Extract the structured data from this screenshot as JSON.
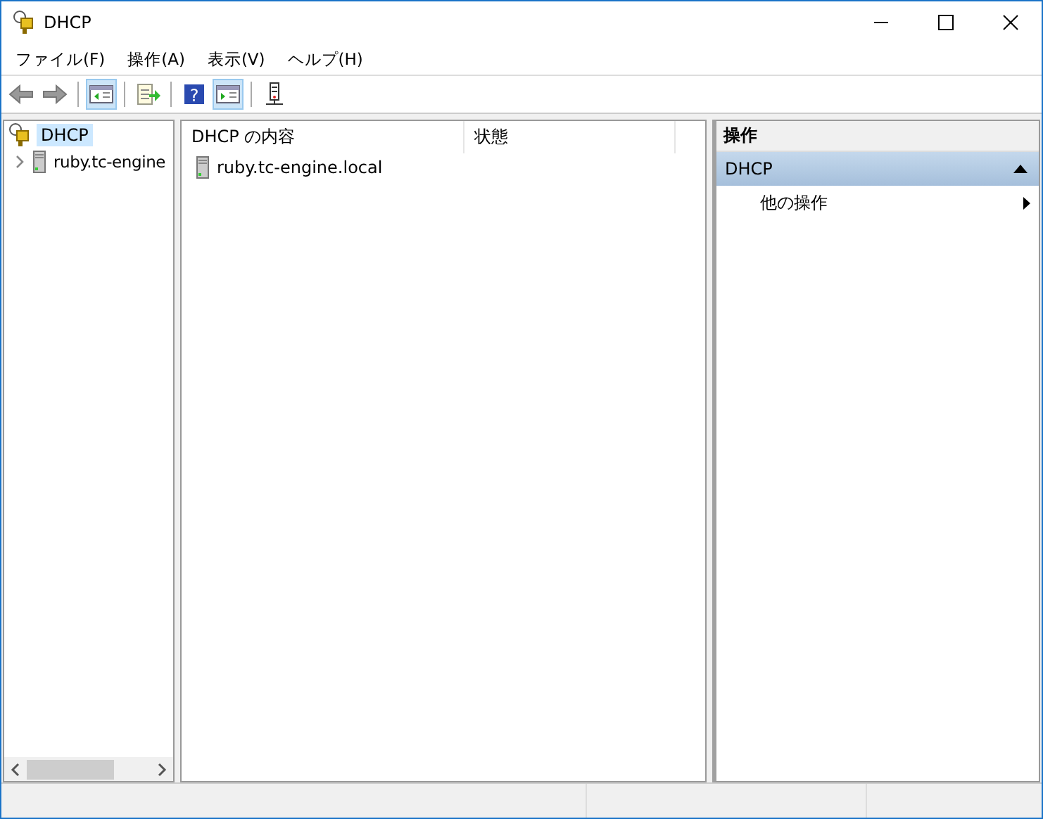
{
  "window": {
    "title": "DHCP"
  },
  "menu": [
    {
      "label": "ファイル(F)"
    },
    {
      "label": "操作(A)"
    },
    {
      "label": "表示(V)"
    },
    {
      "label": "ヘルプ(H)"
    }
  ],
  "toolbar": [
    {
      "kind": "back",
      "selected": false
    },
    {
      "kind": "forward",
      "selected": false
    },
    {
      "kind": "sep"
    },
    {
      "kind": "tree",
      "selected": true
    },
    {
      "kind": "sep"
    },
    {
      "kind": "export",
      "selected": false
    },
    {
      "kind": "sep"
    },
    {
      "kind": "help",
      "selected": false,
      "glyph": "?"
    },
    {
      "kind": "actionpane",
      "selected": true
    },
    {
      "kind": "sep"
    },
    {
      "kind": "device",
      "selected": false
    }
  ],
  "tree": [
    {
      "label": "DHCP",
      "selected": true,
      "children": [
        {
          "label": "ruby.tc-engine",
          "selected": false,
          "expanded": false
        }
      ]
    }
  ],
  "table": {
    "columns": [
      "DHCP の内容",
      "状態"
    ],
    "rows": [
      {
        "name": "ruby.tc-engine.local"
      }
    ]
  },
  "actions": {
    "title": "操作",
    "groups": [
      {
        "label": "DHCP",
        "expanded": true,
        "items": [
          {
            "label": "他の操作"
          }
        ]
      }
    ]
  }
}
